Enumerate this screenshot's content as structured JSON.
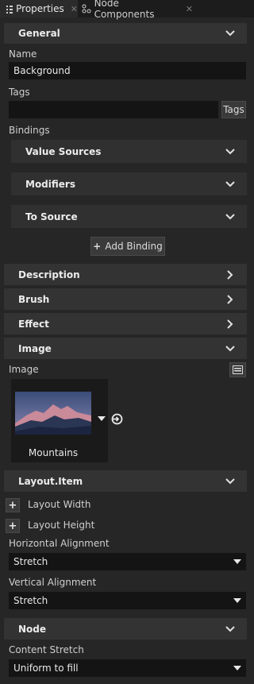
{
  "tabs": [
    {
      "label": "Properties",
      "active": true
    },
    {
      "label": "Node Components",
      "active": false
    }
  ],
  "general": {
    "title": "General",
    "name_label": "Name",
    "name_value": "Background",
    "tags_label": "Tags",
    "tags_value": "",
    "tags_button": "Tags",
    "bindings_label": "Bindings",
    "value_sources": "Value Sources",
    "modifiers": "Modifiers",
    "to_source": "To Source",
    "add_binding": "Add Binding"
  },
  "sections": {
    "description": "Description",
    "brush": "Brush",
    "effect": "Effect",
    "image": "Image",
    "layout_item": "Layout.Item",
    "node": "Node"
  },
  "image": {
    "label": "Image",
    "asset_name": "Mountains"
  },
  "layout": {
    "layout_width": "Layout Width",
    "layout_height": "Layout Height",
    "h_align_label": "Horizontal Alignment",
    "h_align_value": "Stretch",
    "v_align_label": "Vertical Alignment",
    "v_align_value": "Stretch"
  },
  "node": {
    "content_stretch_label": "Content Stretch",
    "content_stretch_value": "Uniform to fill"
  },
  "colors": {
    "background": "#262626",
    "section": "#333333",
    "field": "#141414",
    "text": "#d6d6d6"
  }
}
